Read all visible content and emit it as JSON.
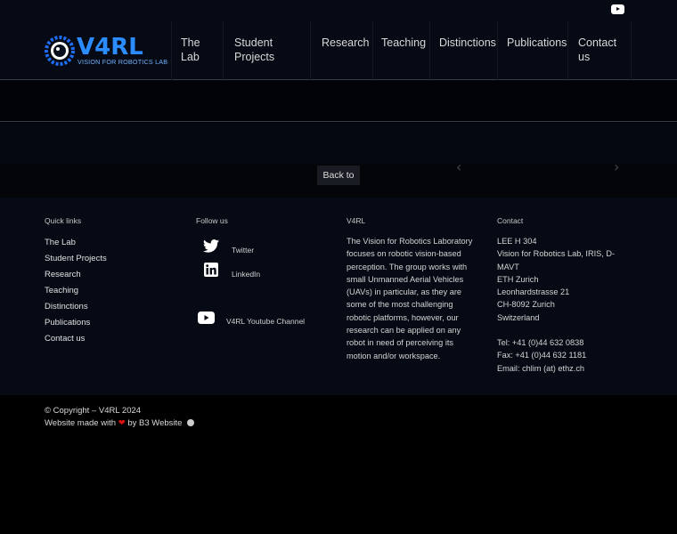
{
  "header": {
    "logo_text": "V4RL",
    "logo_subtitle": "VISION FOR ROBOTICS LAB",
    "nav": [
      {
        "label": "The Lab"
      },
      {
        "label": "Student Projects"
      },
      {
        "label": "Research"
      },
      {
        "label": "Teaching"
      },
      {
        "label": "Distinctions"
      },
      {
        "label": "Publications"
      },
      {
        "label": "Contact us"
      }
    ]
  },
  "slider": {
    "back_label": "Back to",
    "prev_icon": "chevron-left-icon",
    "next_icon": "chevron-right-icon"
  },
  "footer": {
    "quick_links": {
      "heading": "Quick links",
      "items": [
        "The Lab",
        "Student Projects",
        "Research",
        "Teaching",
        "Distinctions",
        "Publications",
        "Contact us"
      ]
    },
    "follow": {
      "heading": "Follow us",
      "items": [
        {
          "label": "Twitter",
          "icon": "twitter-icon"
        },
        {
          "label": "LinkedIn",
          "icon": "linkedin-icon"
        },
        {
          "label": "V4RL Youtube Channel",
          "icon": "youtube-icon"
        }
      ]
    },
    "about": {
      "heading": "V4RL",
      "lines": [
        "The Vision for Robotics Laboratory",
        "focuses on robotic vision-based",
        "perception. The group works with",
        "small Unmanned Aerial Vehicles",
        "(UAVs) in particular, as they are",
        "some of the most challenging",
        "robotic platforms, however, our",
        "research can be applied on any",
        "robot in need of perceiving its",
        "motion and/or workspace."
      ]
    },
    "contact": {
      "heading": "Contact",
      "address": [
        "LEE H 304",
        "Vision for Robotics Lab, IRIS, D-",
        "MAVT",
        "ETH Zurich",
        "Leonhardstrasse 21",
        "CH-8092 Zurich",
        "Switzerland"
      ],
      "phone": [
        "Tel: +41 (0)44 632 0838",
        "Fax: +41 (0)44 632 1181",
        "Email: chlim (at) ethz.ch"
      ]
    }
  },
  "bottom": {
    "copyright": "© Copyright – V4RL 2024",
    "made_with_prefix": "Website made with",
    "made_with_suffix": "by B3 Website"
  }
}
